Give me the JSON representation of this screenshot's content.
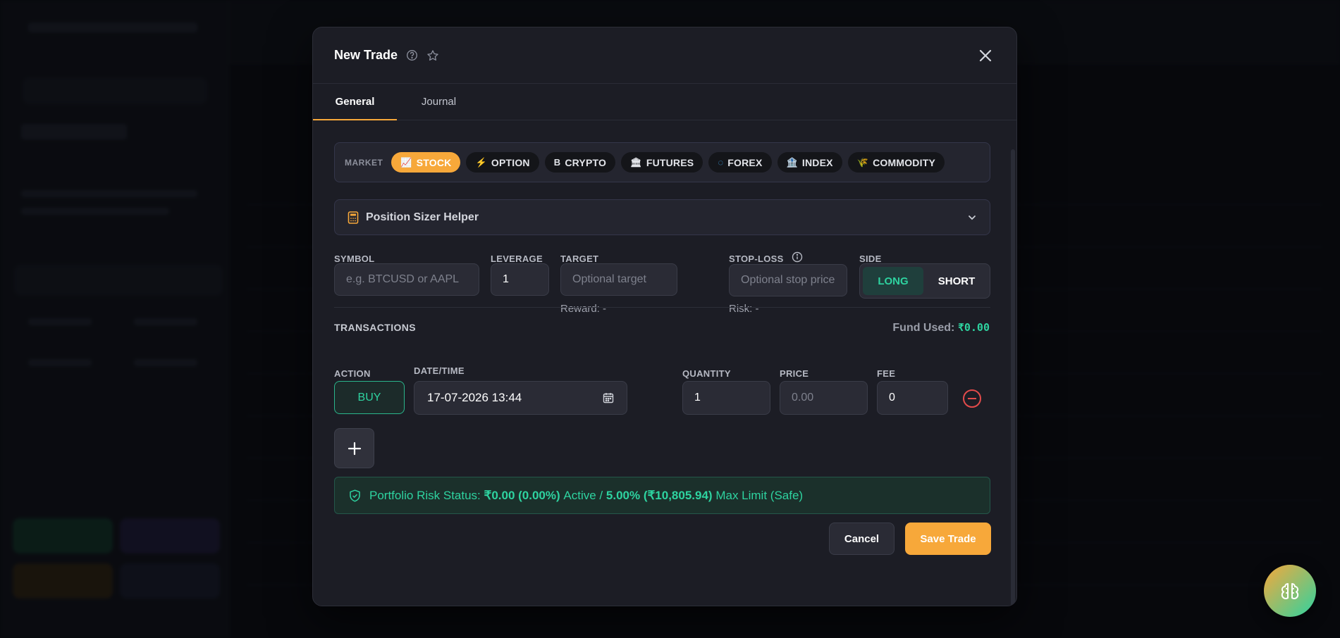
{
  "modal": {
    "title": "New Trade",
    "help_icon": "question-circle-icon",
    "star_icon": "star-icon",
    "close_icon": "close-icon"
  },
  "tabs": [
    {
      "label": "General",
      "active": true
    },
    {
      "label": "Journal",
      "active": false
    }
  ],
  "market": {
    "label": "MARKET",
    "chips": [
      {
        "label": "STOCK",
        "icon": "📈",
        "active": true
      },
      {
        "label": "OPTION",
        "icon": "⚡",
        "active": false
      },
      {
        "label": "CRYPTO",
        "icon": "B",
        "active": false
      },
      {
        "label": "FUTURES",
        "icon": "🏛",
        "active": false
      },
      {
        "label": "FOREX",
        "icon": "◌",
        "active": false
      },
      {
        "label": "INDEX",
        "icon": "🏦",
        "active": false
      },
      {
        "label": "COMMODITY",
        "icon": "🌾",
        "active": false
      }
    ]
  },
  "sizer": {
    "label": "Position Sizer Helper",
    "icon": "calculator-icon"
  },
  "fields": {
    "symbol": {
      "label": "SYMBOL",
      "placeholder": "e.g. BTCUSD or AAPL"
    },
    "leverage": {
      "label": "LEVERAGE",
      "value": "1"
    },
    "target": {
      "label": "TARGET",
      "placeholder": "Optional target",
      "note": "Reward: -"
    },
    "stoploss": {
      "label": "STOP-LOSS",
      "placeholder": "Optional stop price",
      "note": "Risk: -"
    },
    "side": {
      "label": "SIDE",
      "options": [
        {
          "label": "LONG",
          "active": true
        },
        {
          "label": "SHORT",
          "active": false
        }
      ]
    }
  },
  "transactions": {
    "title": "TRANSACTIONS",
    "fund_used_label": "Fund Used:",
    "fund_used_value": "₹0.00",
    "headers": {
      "action": "ACTION",
      "datetime": "DATE/TIME",
      "quantity": "QUANTITY",
      "price": "PRICE",
      "fee": "FEE"
    },
    "row": {
      "action": "BUY",
      "datetime": "17-07-2026 13:44",
      "quantity": "1",
      "price_placeholder": "0.00",
      "fee": "0"
    }
  },
  "risk": {
    "prefix": "Portfolio Risk Status:",
    "active_value": "₹0.00 (0.00%)",
    "active_label": "Active /",
    "max_value": "5.00% (₹10,805.94)",
    "max_label": "Max Limit (Safe)"
  },
  "actions": {
    "cancel": "Cancel",
    "save": "Save Trade"
  },
  "colors": {
    "accent": "#f7a83a",
    "positive": "#2ed3a0",
    "danger": "#e34b4b",
    "modal_bg": "#1c1d25"
  }
}
